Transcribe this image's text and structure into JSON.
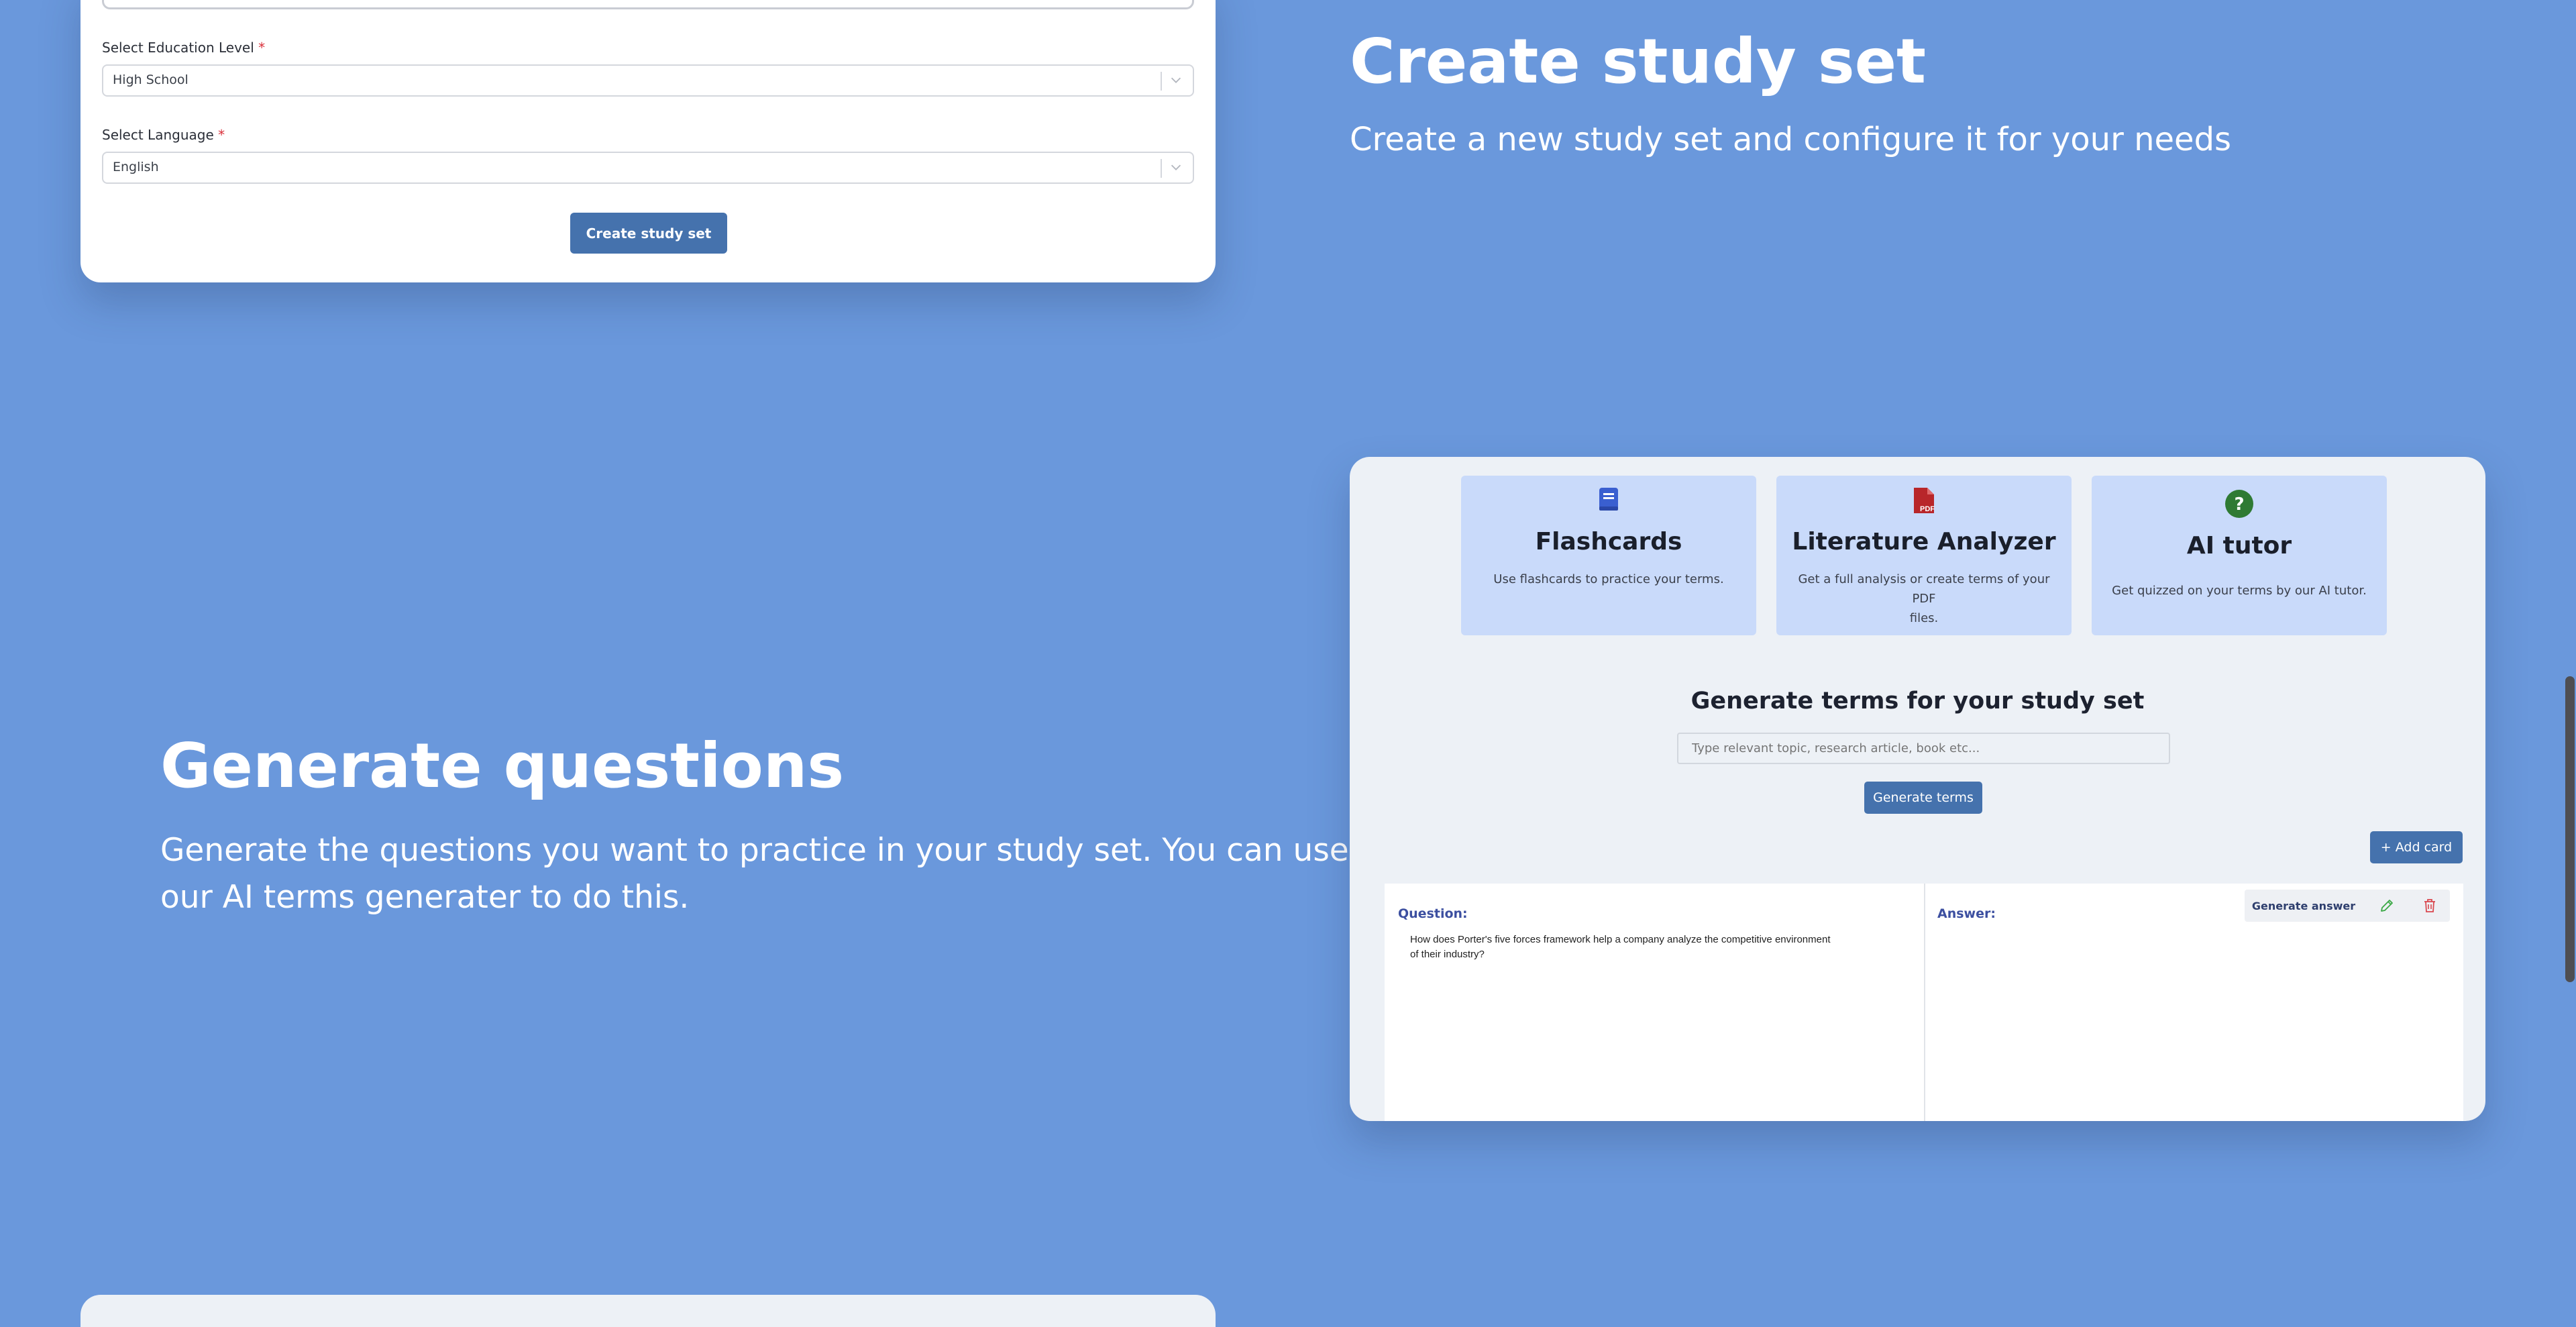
{
  "form": {
    "education_label": "Select Education Level",
    "education_required": "*",
    "education_value": "High School",
    "language_label": "Select Language",
    "language_required": "*",
    "language_value": "English",
    "create_button": "Create study set"
  },
  "section_create": {
    "title": "Create study set",
    "subtitle": "Create a new study set and configure it for your needs"
  },
  "section_generate": {
    "title": "Generate questions",
    "subtitle_line1": "Generate the questions you want to practice in your study set. You can use",
    "subtitle_line2": "our AI terms generater to do this."
  },
  "features": [
    {
      "title": "Flashcards",
      "desc": "Use flashcards to practice your terms.",
      "icon": "book-icon",
      "color": "#3a5fd0"
    },
    {
      "title": "Literature Analyzer",
      "desc_line1": "Get a full analysis or create terms of your PDF",
      "desc_line2": "files.",
      "icon": "pdf-icon",
      "color": "#b8262a"
    },
    {
      "title": "AI tutor",
      "desc": "Get quizzed on your terms by our AI tutor.",
      "icon": "question-icon",
      "color": "#2f7a33"
    }
  ],
  "generator": {
    "title": "Generate terms for your study set",
    "placeholder": "Type relevant topic, research article, book etc...",
    "button": "Generate terms",
    "add_card": "+ Add card"
  },
  "card": {
    "question_label": "Question:",
    "question_line1": "How does Porter's five forces framework help a company analyze the competitive environment",
    "question_line2": "of their industry?",
    "answer_label": "Answer:",
    "generate_answer": "Generate answer"
  },
  "colors": {
    "background": "#6a98dc",
    "primary_button": "#4572ad",
    "feature_card": "#c9dafa"
  }
}
